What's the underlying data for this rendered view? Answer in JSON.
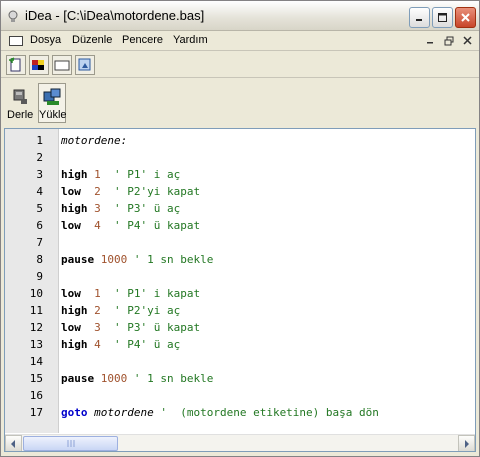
{
  "window": {
    "title": "iDea - [C:\\iDea\\motordene.bas]",
    "controls": {
      "minimize_icon": "minimize-icon",
      "maximize_icon": "maximize-icon",
      "close_icon": "close-icon"
    }
  },
  "menubar": {
    "items": [
      {
        "label": "Dosya"
      },
      {
        "label": "Düzenle"
      },
      {
        "label": "Pencere"
      },
      {
        "label": "Yardım"
      }
    ]
  },
  "toolbar1": {
    "buttons": [
      {
        "icon": "new-file-icon"
      },
      {
        "icon": "colors-icon"
      },
      {
        "icon": "blank-window-icon"
      },
      {
        "icon": "open-folder-icon"
      }
    ]
  },
  "toolbar2": {
    "buttons": [
      {
        "label": "Derle",
        "icon": "compile-icon"
      },
      {
        "label": "Yükle",
        "icon": "upload-icon"
      }
    ]
  },
  "editor": {
    "lines": [
      {
        "n": "1",
        "tokens": [
          {
            "t": "label",
            "v": "motordene:"
          }
        ]
      },
      {
        "n": "2",
        "tokens": []
      },
      {
        "n": "3",
        "tokens": [
          {
            "t": "kw",
            "v": "high"
          },
          {
            "t": "num",
            "v": " 1"
          },
          {
            "t": "cmt",
            "v": "  ' P1' i aç"
          }
        ]
      },
      {
        "n": "4",
        "tokens": [
          {
            "t": "kw",
            "v": "low"
          },
          {
            "t": "num",
            "v": "  2"
          },
          {
            "t": "cmt",
            "v": "  ' P2'yi kapat"
          }
        ]
      },
      {
        "n": "5",
        "tokens": [
          {
            "t": "kw",
            "v": "high"
          },
          {
            "t": "num",
            "v": " 3"
          },
          {
            "t": "cmt",
            "v": "  ' P3' ü aç"
          }
        ]
      },
      {
        "n": "6",
        "tokens": [
          {
            "t": "kw",
            "v": "low"
          },
          {
            "t": "num",
            "v": "  4"
          },
          {
            "t": "cmt",
            "v": "  ' P4' ü kapat"
          }
        ]
      },
      {
        "n": "7",
        "tokens": []
      },
      {
        "n": "8",
        "tokens": [
          {
            "t": "kw",
            "v": "pause"
          },
          {
            "t": "num",
            "v": " 1000"
          },
          {
            "t": "cmt",
            "v": " ' 1 sn bekle"
          }
        ]
      },
      {
        "n": "9",
        "tokens": []
      },
      {
        "n": "10",
        "tokens": [
          {
            "t": "kw",
            "v": "low"
          },
          {
            "t": "num",
            "v": "  1"
          },
          {
            "t": "cmt",
            "v": "  ' P1' i kapat"
          }
        ]
      },
      {
        "n": "11",
        "tokens": [
          {
            "t": "kw",
            "v": "high"
          },
          {
            "t": "num",
            "v": " 2"
          },
          {
            "t": "cmt",
            "v": "  ' P2'yi aç"
          }
        ]
      },
      {
        "n": "12",
        "tokens": [
          {
            "t": "kw",
            "v": "low"
          },
          {
            "t": "num",
            "v": "  3"
          },
          {
            "t": "cmt",
            "v": "  ' P3' ü kapat"
          }
        ]
      },
      {
        "n": "13",
        "tokens": [
          {
            "t": "kw",
            "v": "high"
          },
          {
            "t": "num",
            "v": " 4"
          },
          {
            "t": "cmt",
            "v": "  ' P4' ü aç"
          }
        ]
      },
      {
        "n": "14",
        "tokens": []
      },
      {
        "n": "15",
        "tokens": [
          {
            "t": "kw",
            "v": "pause"
          },
          {
            "t": "num",
            "v": " 1000"
          },
          {
            "t": "cmt",
            "v": " ' 1 sn bekle"
          }
        ]
      },
      {
        "n": "16",
        "tokens": []
      },
      {
        "n": "17",
        "tokens": [
          {
            "t": "goto",
            "v": "goto"
          },
          {
            "t": "label",
            "v": " motordene"
          },
          {
            "t": "cmt",
            "v": " '  (motordene etiketine) başa dön"
          }
        ]
      }
    ]
  },
  "colors": {
    "keyword": "#000000",
    "number": "#a0522d",
    "comment": "#227722",
    "goto": "#0000cc",
    "gutter": "#e8e8e8"
  }
}
